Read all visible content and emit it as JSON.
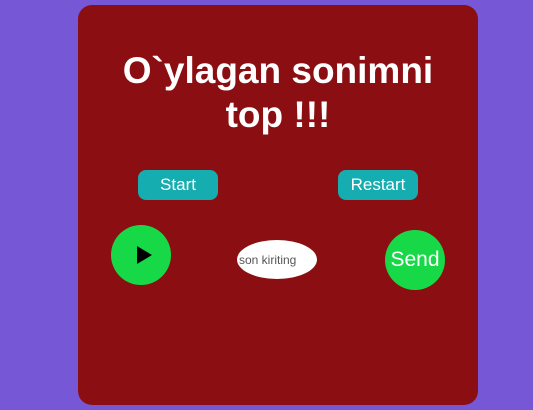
{
  "colors": {
    "page_background": "#7657d6",
    "card_background": "#8b0f12",
    "small_button": "#16adb1",
    "round_button": "#17d947",
    "text": "#ffffff"
  },
  "game": {
    "title_line1": "O`ylagan sonimni",
    "title_line2": "top !!!",
    "start_label": "Start",
    "restart_label": "Restart",
    "play_icon": "play-icon",
    "input_placeholder": "son kiriting",
    "input_value": "",
    "send_label": "Send"
  }
}
